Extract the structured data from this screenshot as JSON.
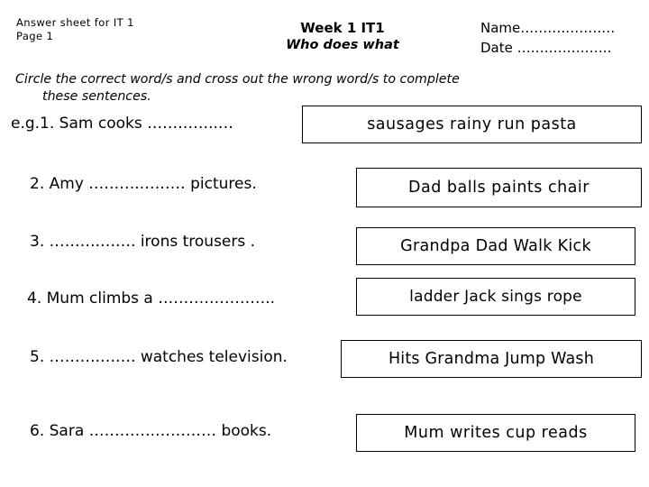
{
  "header": {
    "left_line1": "Answer sheet for IT 1",
    "left_line2": "Page 1",
    "title": "Week 1 IT1",
    "subtitle": "Who does what",
    "name_field": "Name…………………",
    "date_field": "Date …………………"
  },
  "instruction": {
    "line1": "Circle the correct word/s and cross out the wrong word/s to complete",
    "line2": "these sentences."
  },
  "questions": [
    {
      "sentence": "e.g.1. Sam   cooks …………..…",
      "choices": "sausages   rainy    run    pasta"
    },
    {
      "sentence": "2. Amy ……….……… pictures.",
      "choices": "Dad   balls  paints  chair"
    },
    {
      "sentence": "3. ……….……. irons  trousers .",
      "choices": "Grandpa Dad  Walk   Kick"
    },
    {
      "sentence": "4. Mum   climbs  a …………………..",
      "choices": "ladder Jack sings rope"
    },
    {
      "sentence": "5. ……….……. watches  television.",
      "choices": "Hits  Grandma Jump Wash"
    },
    {
      "sentence": "6.  Sara ………….………… books.",
      "choices": "Mum   writes  cup  reads"
    }
  ],
  "colors": {
    "background": "#ffffff",
    "text": "#000000",
    "box_border": "#000000"
  }
}
